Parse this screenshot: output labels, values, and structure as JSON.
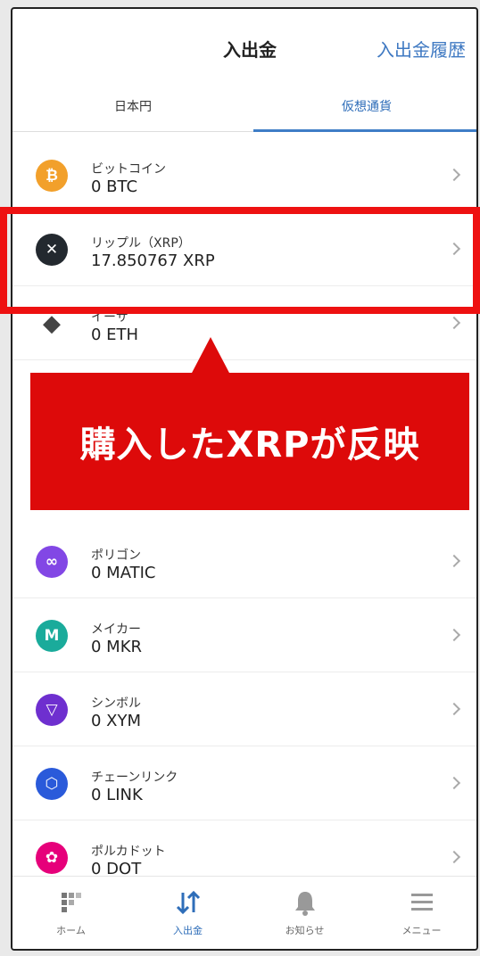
{
  "header": {
    "title": "入出金",
    "history_link": "入出金履歴"
  },
  "tabs": [
    {
      "label": "日本円",
      "active": false
    },
    {
      "label": "仮想通貨",
      "active": true
    }
  ],
  "coins": [
    {
      "name": "ビットコイン",
      "balance": "0 BTC",
      "icon": "bitcoin-icon",
      "color": "#f2a02b",
      "glyph": "₿"
    },
    {
      "name": "リップル（XRP）",
      "balance": "17.850767 XRP",
      "icon": "xrp-icon",
      "color": "#23292f",
      "glyph": "✕"
    },
    {
      "name": "イーサ",
      "balance": "0 ETH",
      "icon": "ethereum-icon",
      "color": "#444444",
      "glyph": "◆"
    },
    {
      "name": "ポリゴン",
      "balance": "0 MATIC",
      "icon": "polygon-icon",
      "color": "#8247e5",
      "glyph": "∞"
    },
    {
      "name": "メイカー",
      "balance": "0 MKR",
      "icon": "maker-icon",
      "color": "#1aab9b",
      "glyph": "M"
    },
    {
      "name": "シンボル",
      "balance": "0 XYM",
      "icon": "symbol-icon",
      "color": "#6e2fcf",
      "glyph": "▽"
    },
    {
      "name": "チェーンリンク",
      "balance": "0 LINK",
      "icon": "chainlink-icon",
      "color": "#2a5ada",
      "glyph": "⬡"
    },
    {
      "name": "ポルカドット",
      "balance": "0 DOT",
      "icon": "polkadot-icon",
      "color": "#e6007a",
      "glyph": "✿"
    }
  ],
  "annotation": {
    "callout_text": "購入したXRPが反映",
    "color": "#dd0a0a"
  },
  "nav": [
    {
      "label": "ホーム",
      "icon": "home-icon",
      "active": false
    },
    {
      "label": "入出金",
      "icon": "transfer-icon",
      "active": true
    },
    {
      "label": "お知らせ",
      "icon": "bell-icon",
      "active": false
    },
    {
      "label": "メニュー",
      "icon": "menu-icon",
      "active": false
    }
  ]
}
